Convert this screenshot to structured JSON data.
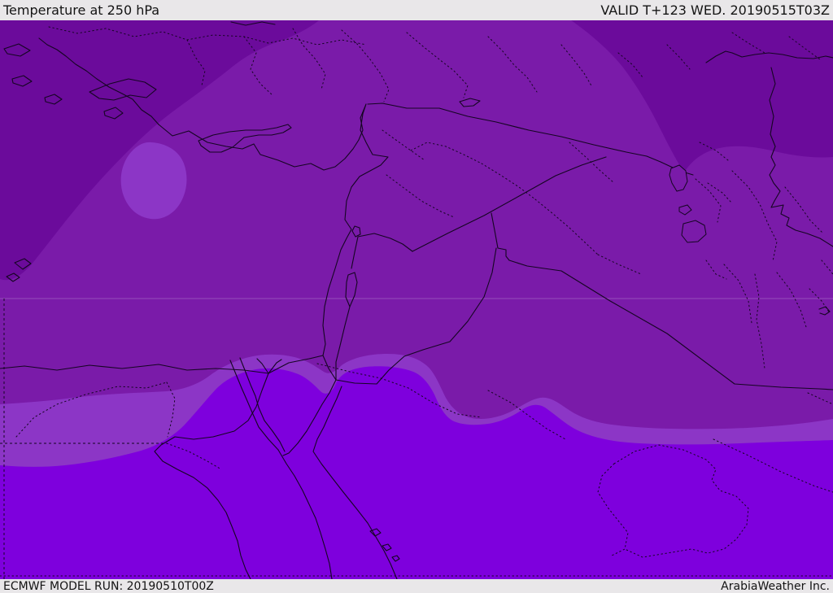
{
  "header": {
    "title": "Temperature at 250 hPa",
    "valid_label": "VALID T+123 WED. 20190515T03Z"
  },
  "footer": {
    "model_run": "ECMWF MODEL RUN: 20190510T00Z",
    "brand": "ArabiaWeather Inc."
  },
  "map": {
    "kind": "filled-contour temperature field, Middle East / Eastern Mediterranean",
    "colors": {
      "band_coldest": "#6b0b9b",
      "band_cold": "#7a1ba9",
      "band_mild": "#8c36c6",
      "band_warm": "#7e00dd",
      "line": "#150522",
      "lake_fill": "#7a1ba9"
    }
  },
  "ui": {
    "bar_background": "#e9e7e9",
    "bar_text_color": "#141414"
  }
}
